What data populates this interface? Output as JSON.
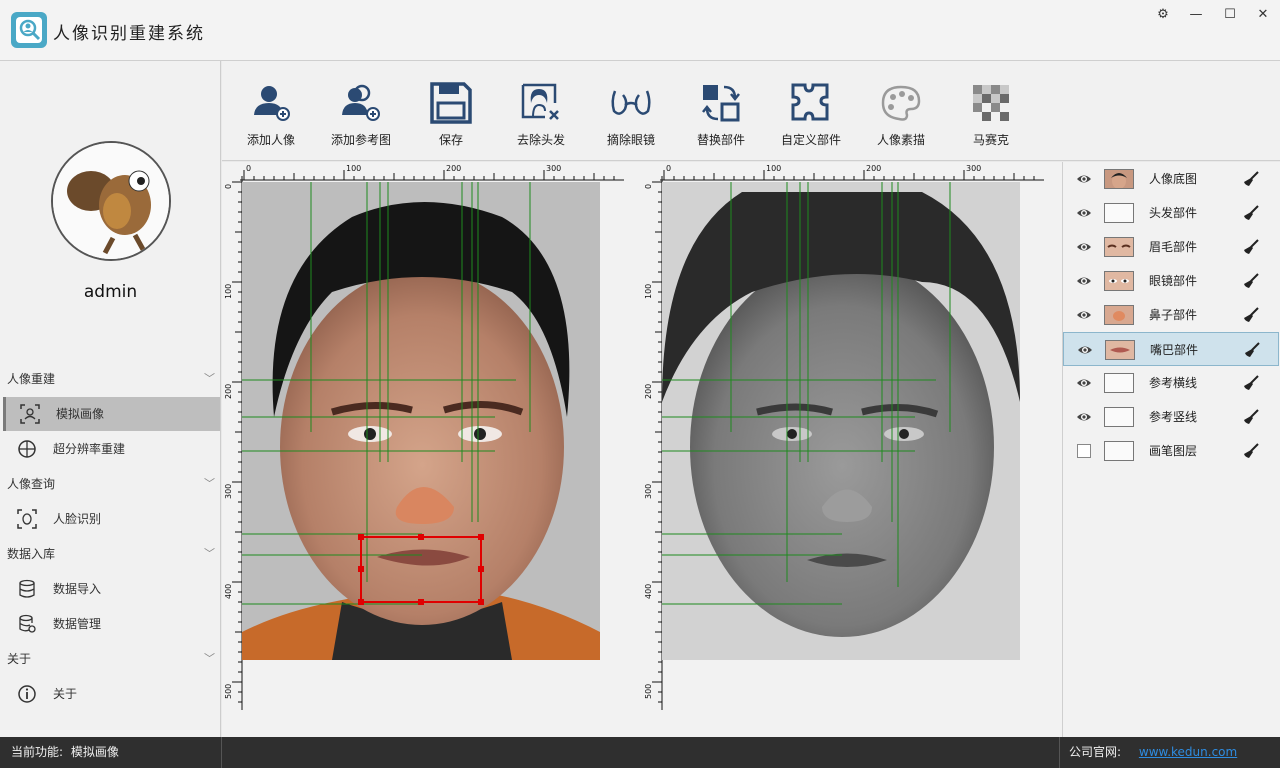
{
  "app": {
    "title": "人像识别重建系统",
    "window_buttons": [
      "⚙",
      "—",
      "☐",
      "✕"
    ]
  },
  "sidebar": {
    "username": "admin",
    "sections": [
      {
        "label": "人像重建",
        "items": [
          {
            "label": "模拟画像",
            "icon": "face-scan-icon",
            "active": true
          },
          {
            "label": "超分辨率重建",
            "icon": "globe-icon",
            "active": false
          }
        ]
      },
      {
        "label": "人像查询",
        "items": [
          {
            "label": "人脸识别",
            "icon": "face-recognition-icon",
            "active": false
          }
        ]
      },
      {
        "label": "数据入库",
        "items": [
          {
            "label": "数据导入",
            "icon": "database-icon",
            "active": false
          },
          {
            "label": "数据管理",
            "icon": "database-settings-icon",
            "active": false
          }
        ]
      },
      {
        "label": "关于",
        "items": [
          {
            "label": "关于",
            "icon": "info-icon",
            "active": false
          }
        ]
      }
    ]
  },
  "toolbar": {
    "tools": [
      {
        "label": "添加人像",
        "icon": "add-person-icon"
      },
      {
        "label": "添加参考图",
        "icon": "add-reference-icon"
      },
      {
        "label": "保存",
        "icon": "save-icon"
      },
      {
        "label": "去除头发",
        "icon": "remove-hair-icon"
      },
      {
        "label": "摘除眼镜",
        "icon": "remove-glasses-icon"
      },
      {
        "label": "替换部件",
        "icon": "replace-part-icon"
      },
      {
        "label": "自定义部件",
        "icon": "custom-part-icon"
      },
      {
        "label": "人像素描",
        "icon": "palette-icon"
      },
      {
        "label": "马赛克",
        "icon": "mosaic-icon"
      }
    ]
  },
  "canvas": {
    "ruler_labels_x": [
      "0",
      "100",
      "200",
      "300"
    ],
    "ruler_labels_y": [
      "0",
      "100",
      "200",
      "300",
      "400",
      "500"
    ]
  },
  "layers": [
    {
      "label": "人像底图",
      "visible": true,
      "thumb": "face",
      "selected": false
    },
    {
      "label": "头发部件",
      "visible": true,
      "thumb": "blank",
      "selected": false
    },
    {
      "label": "眉毛部件",
      "visible": true,
      "thumb": "brows",
      "selected": false
    },
    {
      "label": "眼镜部件",
      "visible": true,
      "thumb": "eyes",
      "selected": false
    },
    {
      "label": "鼻子部件",
      "visible": true,
      "thumb": "nose",
      "selected": false
    },
    {
      "label": "嘴巴部件",
      "visible": true,
      "thumb": "mouth",
      "selected": true
    },
    {
      "label": "参考横线",
      "visible": true,
      "thumb": "blank",
      "selected": false
    },
    {
      "label": "参考竖线",
      "visible": true,
      "thumb": "blank",
      "selected": false
    },
    {
      "label": "画笔图层",
      "visible": false,
      "thumb": "blank",
      "selected": false
    }
  ],
  "status": {
    "current_label": "当前功能:",
    "current_value": "模拟画像",
    "site_label": "公司官网:",
    "site_url": "www.kedun.com"
  },
  "colors": {
    "accent": "#2b4a73",
    "guide_line": "#1f8a1f",
    "selection": "#e00000",
    "status_bg": "#2f2f2f",
    "link": "#2e8ce0"
  }
}
